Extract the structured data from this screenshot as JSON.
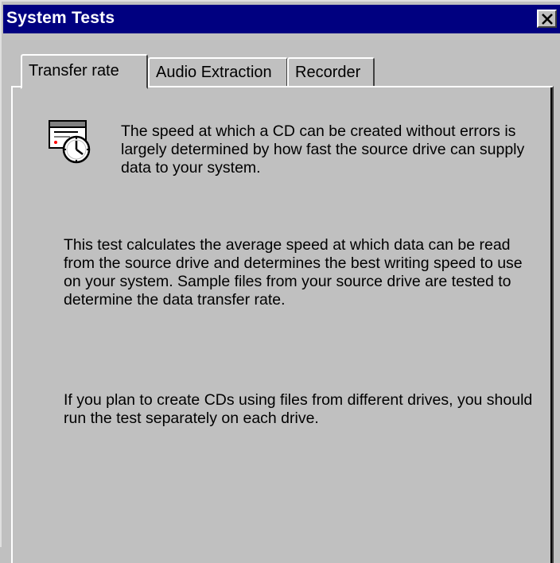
{
  "window": {
    "title": "System Tests"
  },
  "titlebar": {
    "close_icon": "close-x-icon"
  },
  "tabs": [
    {
      "label": "Transfer rate",
      "active": true
    },
    {
      "label": "Audio Extraction",
      "active": false
    },
    {
      "label": "Recorder",
      "active": false
    }
  ],
  "content": {
    "icon": "drive-clock-icon",
    "paragraph1": "The speed at which a CD can be created without errors is largely determined by how fast the source drive can supply data to your system.",
    "paragraph2": "This test calculates the average speed at which data can be read from the source drive and determines the best writing speed to use on your system.  Sample files from your source drive are tested to determine the data transfer rate.",
    "paragraph3": "If you plan to create CDs using files from different drives, you should run the test separately on each drive."
  },
  "colors": {
    "titlebar": "#000080",
    "face": "#c0c0c0"
  }
}
